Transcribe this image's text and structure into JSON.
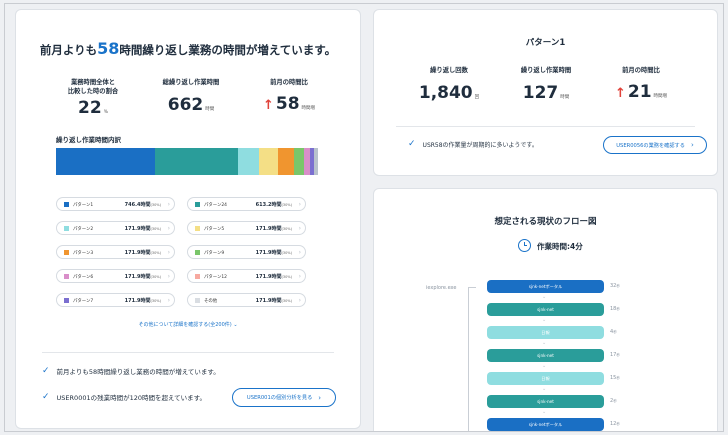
{
  "left": {
    "headline": {
      "pre": "前月よりも",
      "num": "58",
      "post": "時間繰り返し業務の時間が増えています。"
    },
    "stats": [
      {
        "label": "業務時間全体と\n比較した時の割合",
        "value": "22",
        "unit": "%"
      },
      {
        "label": "総繰り返し作業時間",
        "value": "662",
        "unit": "時間"
      },
      {
        "label": "前月の時間比",
        "value": "58",
        "unit": "時間増",
        "arrow": "↑"
      }
    ],
    "breakdown_title": "繰り返し作業時間内訳",
    "breakdown_share": [
      {
        "color": "#1a6fc4",
        "pct": 37
      },
      {
        "color": "#2a9d9a",
        "pct": 31
      },
      {
        "color": "#8fdde0",
        "pct": 8
      },
      {
        "color": "#f4df86",
        "pct": 7
      },
      {
        "color": "#f0952f",
        "pct": 6
      },
      {
        "color": "#7ac66a",
        "pct": 4
      },
      {
        "color": "#d98ec9",
        "pct": 2
      },
      {
        "color": "#7b6fd0",
        "pct": 1.5
      },
      {
        "color": "#b8c2cc",
        "pct": 1.5
      }
    ],
    "patterns": [
      {
        "name": "パターン1",
        "value": "746.4時間",
        "pct": "(30%)",
        "color": "#1a6fc4"
      },
      {
        "name": "パターン24",
        "value": "613.2時間",
        "pct": "(30%)",
        "color": "#2a9d9a"
      },
      {
        "name": "パターン2",
        "value": "171.9時間",
        "pct": "(30%)",
        "color": "#8fdde0"
      },
      {
        "name": "パターン5",
        "value": "171.9時間",
        "pct": "(30%)",
        "color": "#f4df86"
      },
      {
        "name": "パターン3",
        "value": "171.9時間",
        "pct": "(30%)",
        "color": "#f0952f"
      },
      {
        "name": "パターン9",
        "value": "171.9時間",
        "pct": "(30%)",
        "color": "#7ac66a"
      },
      {
        "name": "パターン6",
        "value": "171.9時間",
        "pct": "(30%)",
        "color": "#d98ec9"
      },
      {
        "name": "パターン12",
        "value": "171.9時間",
        "pct": "(30%)",
        "color": "#f7a9a0"
      },
      {
        "name": "パターン7",
        "value": "171.9時間",
        "pct": "(30%)",
        "color": "#7b6fd0"
      },
      {
        "name": "その他",
        "value": "171.9時間",
        "pct": "(30%)",
        "color": "#d9dde2"
      }
    ],
    "more_link": "その他について詳細を確認する(全200件)  ⌄",
    "checks": [
      "前月よりも58時間繰り返し業務の時間が増えています。",
      "USER0001の残業時間が120時間を超えています。"
    ],
    "user_button": "USER001の個別分析を見る"
  },
  "right_top": {
    "title": "パターン1",
    "stats": [
      {
        "label": "繰り返し回数",
        "value": "1,840",
        "unit": "回"
      },
      {
        "label": "繰り返し作業時間",
        "value": "127",
        "unit": "時間"
      },
      {
        "label": "前月の時間比",
        "value": "21",
        "unit": "時間増",
        "arrow": "↑"
      }
    ],
    "check": "USR58の作業量が周期的に多いようです。",
    "button": "USER0056の業務を確認する"
  },
  "right_bottom": {
    "title": "想定される現状のフロー図",
    "work_time": "作業時間:4分",
    "app_label": "iexplore.exe",
    "steps": [
      {
        "label": "sjnk-netポータル",
        "time": "32",
        "unit": "秒",
        "color": "#1a6fc4"
      },
      {
        "label": "sjnk-net",
        "time": "18",
        "unit": "秒",
        "color": "#2a9d9a"
      },
      {
        "label": "日報",
        "time": "4",
        "unit": "秒",
        "color": "#8fdde0"
      },
      {
        "label": "sjnk-net",
        "time": "17",
        "unit": "秒",
        "color": "#2a9d9a"
      },
      {
        "label": "日報",
        "time": "15",
        "unit": "秒",
        "color": "#8fdde0"
      },
      {
        "label": "sjnk-net",
        "time": "2",
        "unit": "秒",
        "color": "#2a9d9a"
      },
      {
        "label": "sjnk-netポータル",
        "time": "12",
        "unit": "秒",
        "color": "#1a6fc4"
      }
    ]
  }
}
